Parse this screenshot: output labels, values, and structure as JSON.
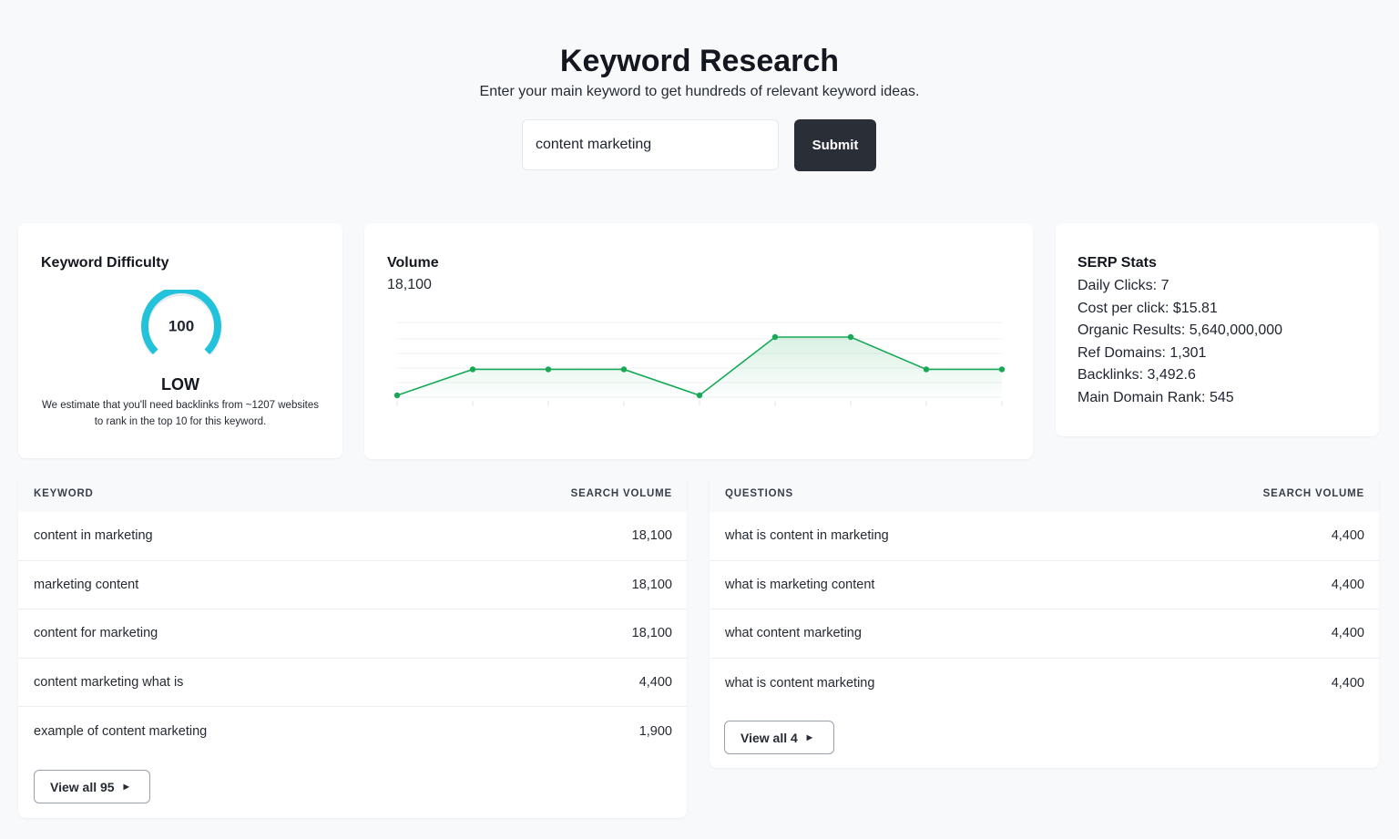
{
  "header": {
    "title": "Keyword Research",
    "subtitle": "Enter your main keyword to get hundreds of relevant keyword ideas."
  },
  "search": {
    "value": "content marketing",
    "submit_label": "Submit"
  },
  "keyword_difficulty": {
    "title": "Keyword Difficulty",
    "score": "100",
    "score_fraction": 1.0,
    "level": "LOW",
    "description": "We estimate that you'll need backlinks from ~1207 websites to rank in the top 10 for this keyword.",
    "gauge_color": "#22c3da"
  },
  "volume": {
    "title": "Volume",
    "value": "18,100",
    "line_color": "#18a957"
  },
  "chart_data": {
    "type": "line",
    "title": "Volume",
    "series": [
      {
        "values": [
          14800,
          18100,
          18100,
          18100,
          14800,
          22200,
          22200,
          18100,
          18100
        ]
      }
    ],
    "grid": true
  },
  "serp_stats": {
    "title": "SERP Stats",
    "items": [
      "Daily Clicks: 7",
      "Cost per click: $15.81",
      "Organic Results: 5,640,000,000",
      "Ref Domains: 1,301",
      "Backlinks: 3,492.6",
      "Main Domain Rank: 545"
    ]
  },
  "keywords_table": {
    "col_keyword": "KEYWORD",
    "col_volume": "SEARCH VOLUME",
    "rows": [
      {
        "keyword": "content in marketing",
        "volume": "18,100"
      },
      {
        "keyword": "marketing content",
        "volume": "18,100"
      },
      {
        "keyword": "content for marketing",
        "volume": "18,100"
      },
      {
        "keyword": "content marketing what is",
        "volume": "4,400"
      },
      {
        "keyword": "example of content marketing",
        "volume": "1,900"
      }
    ],
    "view_all_label": "View all 95"
  },
  "questions_table": {
    "col_question": "QUESTIONS",
    "col_volume": "SEARCH VOLUME",
    "rows": [
      {
        "question": "what is content in marketing",
        "volume": "4,400"
      },
      {
        "question": "what is marketing content",
        "volume": "4,400"
      },
      {
        "question": "what content marketing",
        "volume": "4,400"
      },
      {
        "question": "what is content marketing",
        "volume": "4,400"
      }
    ],
    "view_all_label": "View all 4"
  }
}
